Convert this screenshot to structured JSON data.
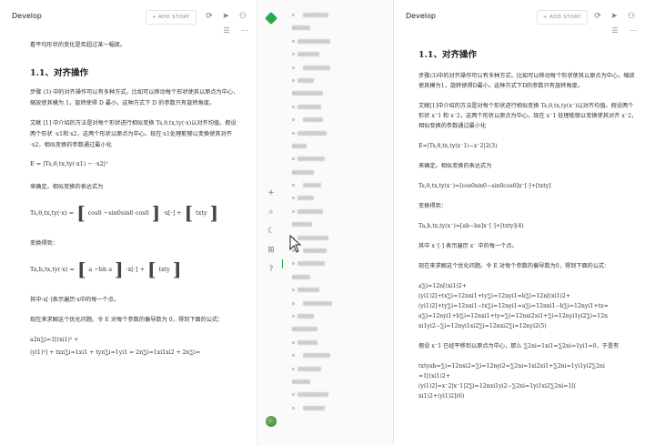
{
  "left_pane": {
    "breadcrumb": "Develop",
    "add_story_label": "+ ADD STORY",
    "icons": [
      "refresh-icon",
      "send-icon",
      "share-users-icon",
      "menu-icon",
      "more-icon"
    ],
    "content": {
      "intro": "看平均形状的变化是否超过某一幅度。",
      "heading": "1.1、对齐操作",
      "p1": "步骤 (3) 中的对齐操作可以有多种方式。比如可以移动每个形状使其以原点为中心，缩放使其模为 1，旋转使得 D 最小。这种方式下 D 的参数只有旋转角度。",
      "p2": "文献 [1] 中介绍的方法是对每个形状进行相似变换 Ts,θ,tx,ty(·x)以对齐均值。假设两个形状 ·x1和·x2，这两个形状以原点为中心。现在·x1处理能够以变换使其对齐·x2，相似变换的参数通过最小化",
      "eq1": "E = |Ts,θ,tx,ty(·x1) − ·x2|²",
      "p3": "来确定。相似变换的表达式为",
      "eq2_lhs": "Ts,θ,tx,ty(·x) = ",
      "eq2_mid": "cos0   −sin0sin0   cos0",
      "eq2_rhs": "·x[·] + ",
      "eq2_vec": "txty",
      "p4": "变换得到：",
      "eq3_lhs": "Ta,b,tx,ty(·x) = ",
      "eq3_mid": "a   −bb   a",
      "eq3_rhs": "·x[·] + ",
      "eq3_vec": "txty",
      "p5": "其中·x[·]表示遍历·x中的每一个点。",
      "p6": "现在来求解这个优化问题。令 E 对每个参数的偏导数为 0，得到下面的公式：",
      "eq4a": "a2n∑i=1[(xi1)² +",
      "eq4b": "(yi1)²] + txn∑i=1xi1 + tyn∑i=1yi1 = 2n∑i=1xi1xi2 + 2n∑i="
    }
  },
  "sidebar": {
    "rail_icons": [
      "add-icon",
      "search-icon",
      "moon-icon",
      "gift-icon",
      "help-icon"
    ],
    "nav_items_count": 31
  },
  "right_pane": {
    "breadcrumb": "Develop",
    "add_story_label": "+ ADD STORY",
    "icons": [
      "refresh-icon",
      "send-icon",
      "share-users-icon",
      "menu-icon",
      "more-icon"
    ],
    "content": {
      "heading": "1.1、对齐操作",
      "p1": "步骤(3)中的对齐操作可以有多种方式。比如可以移动每个形状使其以原点为中心，缩放使其模为1，旋转使得D最小。这种方式下D的参数只有旋转角度。",
      "p2": "文献[1]中介绍的方法是对每个形状进行相似变换 Ts,θ,tx,ty(x⁻)以对齐均值。假设两个形状 x⁻1 和 x⁻2，这两个形状以原点为中心。现在 x⁻1 处理能够以变换使其对齐 x⁻2，相似变换的参数通过最小化",
      "p3": "E=|Ts,θ,tx,ty(x⁻1)−x⁻2|2(3)",
      "p4": "来确定。相似变换的表达式为",
      "p5": "Ts,θ,tx,ty(x⁻)=[cos0sin0−sin0cos0]x⁻[⋅]+[txty]",
      "p6": "变换得到：",
      "p7": "Ta,b,tx,ty(x⁻)=[ab−ba]x⁻[⋅]+[txty](4)",
      "p8": "其中 x⁻[⋅] 表示遍历 x⁻ 中的每一个点。",
      "p9": "现在来求解这个优化问题。令 E 对每个参数的偏导数为0，得到下面的公式：",
      "eq_lines": [
        "a∑i=12n[(xi1)2+",
        "(yi1)2]+tx∑i=12nxi1+ty∑i=12nyi1=b∑i=12n[(xi1)2+",
        "(yi1)2]+ty∑i=12nxi1−tx∑i=12nyi1=a∑i=12nxi1−b∑i=12nyi1+tx=",
        "a∑i=12nyi1+b∑i=12nxi1+ty=∑i=12nxi2xi1+∑i=12nyi1yi2∑i=12n",
        "xi1yi2−∑i=12nyi1xi2∑i=12nxi2∑i=12nyi2(5)"
      ],
      "p10": "假设 x⁻1 已经平移到以原点为中心，那么 ∑2ni=1xi1=∑2ni=1yi1=0，于是有",
      "eq2_lines": [
        "txtyab=∑i=12nxi2=∑i=12nyi2=∑2ni=1xi2xi1+∑2ni=1yi1yi2∑2ni",
        "=1[(xi1)2+",
        "(yi1)2]=x⁻2|x⁻1|2∑i=12nxi1yi2−∑2ni=1yi1xi2∑2ni=1[(",
        "xi1)2+(yi1)2](6)"
      ]
    }
  },
  "colors": {
    "accent_green": "#2aa84a",
    "text": "#333333",
    "sidebar_bg": "#fafafa"
  }
}
